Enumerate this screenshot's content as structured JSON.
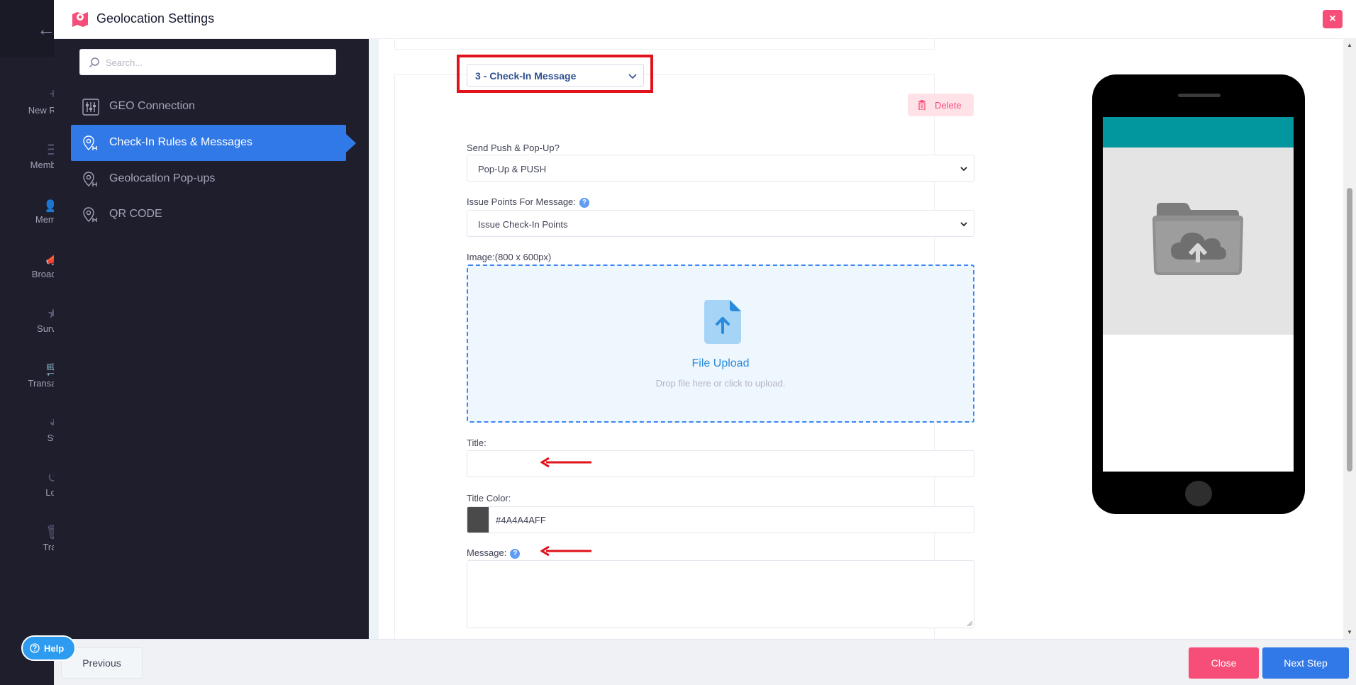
{
  "app": {
    "back_label": "←",
    "sidebar_items": [
      {
        "icon": "plus-icon",
        "glyph": "+",
        "label": "New Re"
      },
      {
        "icon": "list-icon",
        "glyph": "☰",
        "label": "Membe"
      },
      {
        "icon": "users-icon",
        "glyph": "👥",
        "label": "Memb"
      },
      {
        "icon": "megaphone-icon",
        "glyph": "📣",
        "label": "Broadc"
      },
      {
        "icon": "star-icon",
        "glyph": "★",
        "label": "Surve"
      },
      {
        "icon": "cart-icon",
        "glyph": "🛒",
        "label": "Transac"
      },
      {
        "icon": "pie-chart-icon",
        "glyph": "◕",
        "label": "Sta"
      },
      {
        "icon": "history-icon",
        "glyph": "↺",
        "label": "Log"
      },
      {
        "icon": "trash-icon",
        "glyph": "🗑",
        "label": "Tras"
      }
    ]
  },
  "modal": {
    "title": "Geolocation Settings",
    "close_label": "×"
  },
  "nav": {
    "search_placeholder": "Search...",
    "items": [
      {
        "label": "GEO Connection",
        "icon": "sliders-icon"
      },
      {
        "label": "Check-In Rules & Messages",
        "icon": "map-pin-icon",
        "active": true
      },
      {
        "label": "Geolocation Pop-ups",
        "icon": "map-pin-icon"
      },
      {
        "label": "QR CODE",
        "icon": "map-pin-icon"
      }
    ]
  },
  "form": {
    "rule_selector": "3 - Check-In Message",
    "delete_label": "Delete",
    "send_push_label": "Send Push & Pop-Up?",
    "send_push_value": "Pop-Up & PUSH",
    "issue_points_label": "Issue Points For Message:",
    "issue_points_value": "Issue Check-In Points",
    "image_label": "Image:(800 x 600px)",
    "upload_title": "File Upload",
    "upload_hint": "Drop file here or click to upload.",
    "title_label": "Title:",
    "title_value": "",
    "title_color_label": "Title Color:",
    "title_color_value": "#4A4A4AFF",
    "message_label": "Message:",
    "message_value": "",
    "help_glyph": "?"
  },
  "footer": {
    "previous_label": "Previous",
    "close_label": "Close",
    "next_label": "Next Step"
  },
  "help": {
    "label": "Help"
  },
  "colors": {
    "accent_blue": "#3279e8",
    "danger_pink": "#f64e78",
    "sidebar_dark": "#1e1e2d",
    "phone_header_teal": "#02979f",
    "annotation_red": "#e0121b",
    "title_color_swatch": "#4A4A4A"
  }
}
